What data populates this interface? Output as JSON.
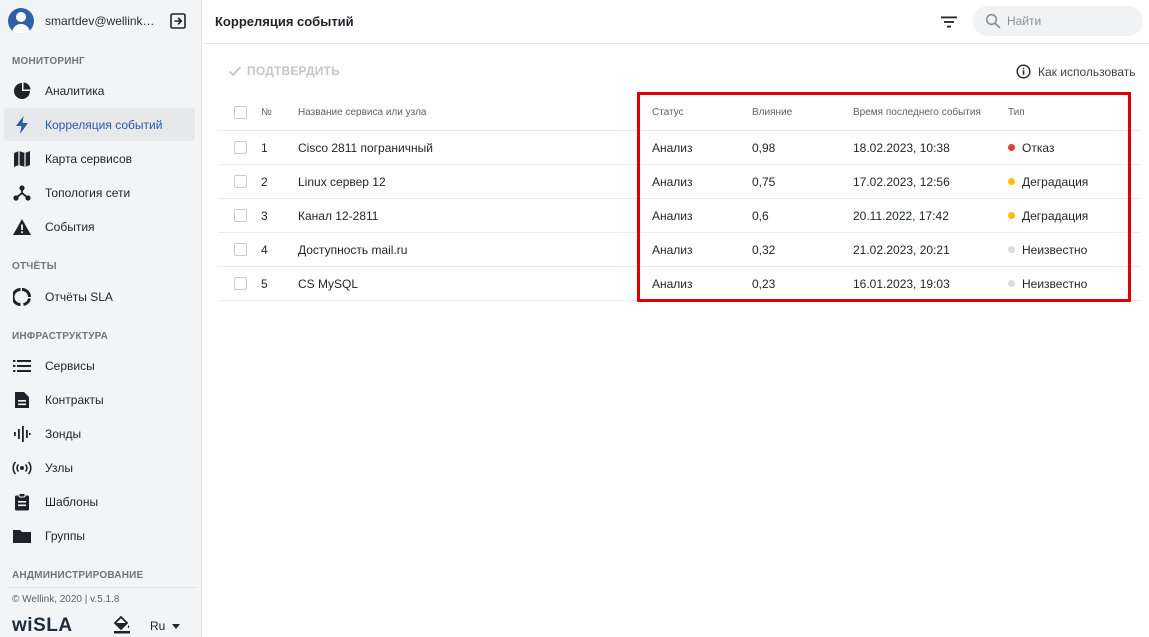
{
  "sidebar": {
    "user": "smartdev@wellink.ru",
    "sections": {
      "monitoring": "МОНИТОРИНГ",
      "reports": "ОТЧЁТЫ",
      "infrastructure": "ИНФРАСТРУКТУРА",
      "admin": "АНДМИНИСТРИРОВАНИЕ"
    },
    "items": {
      "analytics": "Аналитика",
      "correlation": "Корреляция событий",
      "service_map": "Карта сервисов",
      "topology": "Топология сети",
      "events": "События",
      "sla_reports": "Отчёты SLA",
      "services": "Сервисы",
      "contracts": "Контракты",
      "probes": "Зонды",
      "nodes": "Узлы",
      "templates": "Шаблоны",
      "groups": "Группы"
    },
    "active_item": "correlation",
    "copyright": "© Wellink, 2020 | v.5.1.8",
    "brand_main": "wi",
    "brand_rest": "SLA",
    "language": "Ru"
  },
  "header": {
    "title": "Корреляция событий",
    "search_placeholder": "Найти"
  },
  "toolbar": {
    "confirm_label": "ПОДТВЕРДИТЬ",
    "howto_label": "Как использовать"
  },
  "table": {
    "columns": {
      "num": "№",
      "name": "Название сервиса или узла",
      "status": "Статус",
      "impact": "Влияние",
      "time": "Время последнего события",
      "type": "Тип"
    },
    "rows": [
      {
        "num": "1",
        "name": "Cisco 2811 пограничный",
        "status": "Анализ",
        "impact": "0,98",
        "time": "18.02.2023, 10:38",
        "type": "Отказ",
        "type_color": "#e53935"
      },
      {
        "num": "2",
        "name": "Linux сервер 12",
        "status": "Анализ",
        "impact": "0,75",
        "time": "17.02.2023, 12:56",
        "type": "Деградация",
        "type_color": "#f6c000"
      },
      {
        "num": "3",
        "name": "Канал 12-2811",
        "status": "Анализ",
        "impact": "0,6",
        "time": "20.11.2022, 17:42",
        "type": "Деградация",
        "type_color": "#f6c000"
      },
      {
        "num": "4",
        "name": "Доступность mail.ru",
        "status": "Анализ",
        "impact": "0,32",
        "time": "21.02.2023, 20:21",
        "type": "Неизвестно",
        "type_color": "#d9dbde"
      },
      {
        "num": "5",
        "name": "CS MySQL",
        "status": "Анализ",
        "impact": "0,23",
        "time": "16.01.2023, 19:03",
        "type": "Неизвестно",
        "type_color": "#d9dbde"
      }
    ]
  },
  "colors": {
    "accent": "#2a5aa8",
    "highlight": "#e00000"
  }
}
